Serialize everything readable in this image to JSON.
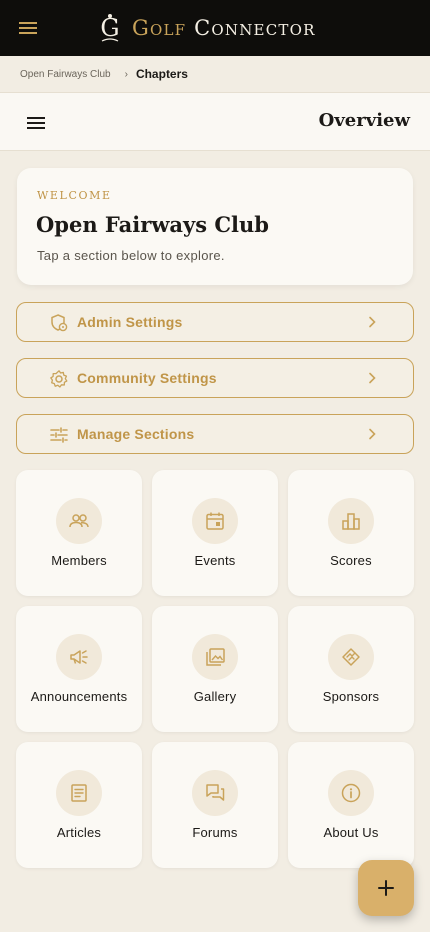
{
  "app": {
    "brand_word1": "Golf",
    "brand_word2": "Connector",
    "logo_letter": "G"
  },
  "breadcrumb": {
    "items": [
      "Open Fairways Club",
      "Chapters"
    ],
    "separator": "›"
  },
  "page": {
    "title": "Overview"
  },
  "welcome": {
    "kicker": "WELCOME",
    "club_name": "Open Fairways Club",
    "subtitle": "Tap a section below to explore."
  },
  "settings_rows": [
    {
      "label": "Admin Settings",
      "icon": "admin-badge-icon"
    },
    {
      "label": "Community Settings",
      "icon": "gear-icon"
    },
    {
      "label": "Manage Sections",
      "icon": "sliders-icon"
    }
  ],
  "sections": [
    {
      "label": "Members",
      "icon": "members-icon"
    },
    {
      "label": "Events",
      "icon": "calendar-icon"
    },
    {
      "label": "Scores",
      "icon": "scores-icon"
    },
    {
      "label": "Announcements",
      "icon": "megaphone-icon"
    },
    {
      "label": "Gallery",
      "icon": "gallery-icon"
    },
    {
      "label": "Sponsors",
      "icon": "sponsors-icon"
    },
    {
      "label": "Articles",
      "icon": "article-icon"
    },
    {
      "label": "Forums",
      "icon": "forum-icon"
    },
    {
      "label": "About Us",
      "icon": "info-icon"
    }
  ],
  "fab": {
    "label": "+"
  },
  "colors": {
    "accent": "#c9a35a",
    "topbar": "#0e0d0b",
    "background": "#f2ede3",
    "fab": "#d9b06a"
  }
}
